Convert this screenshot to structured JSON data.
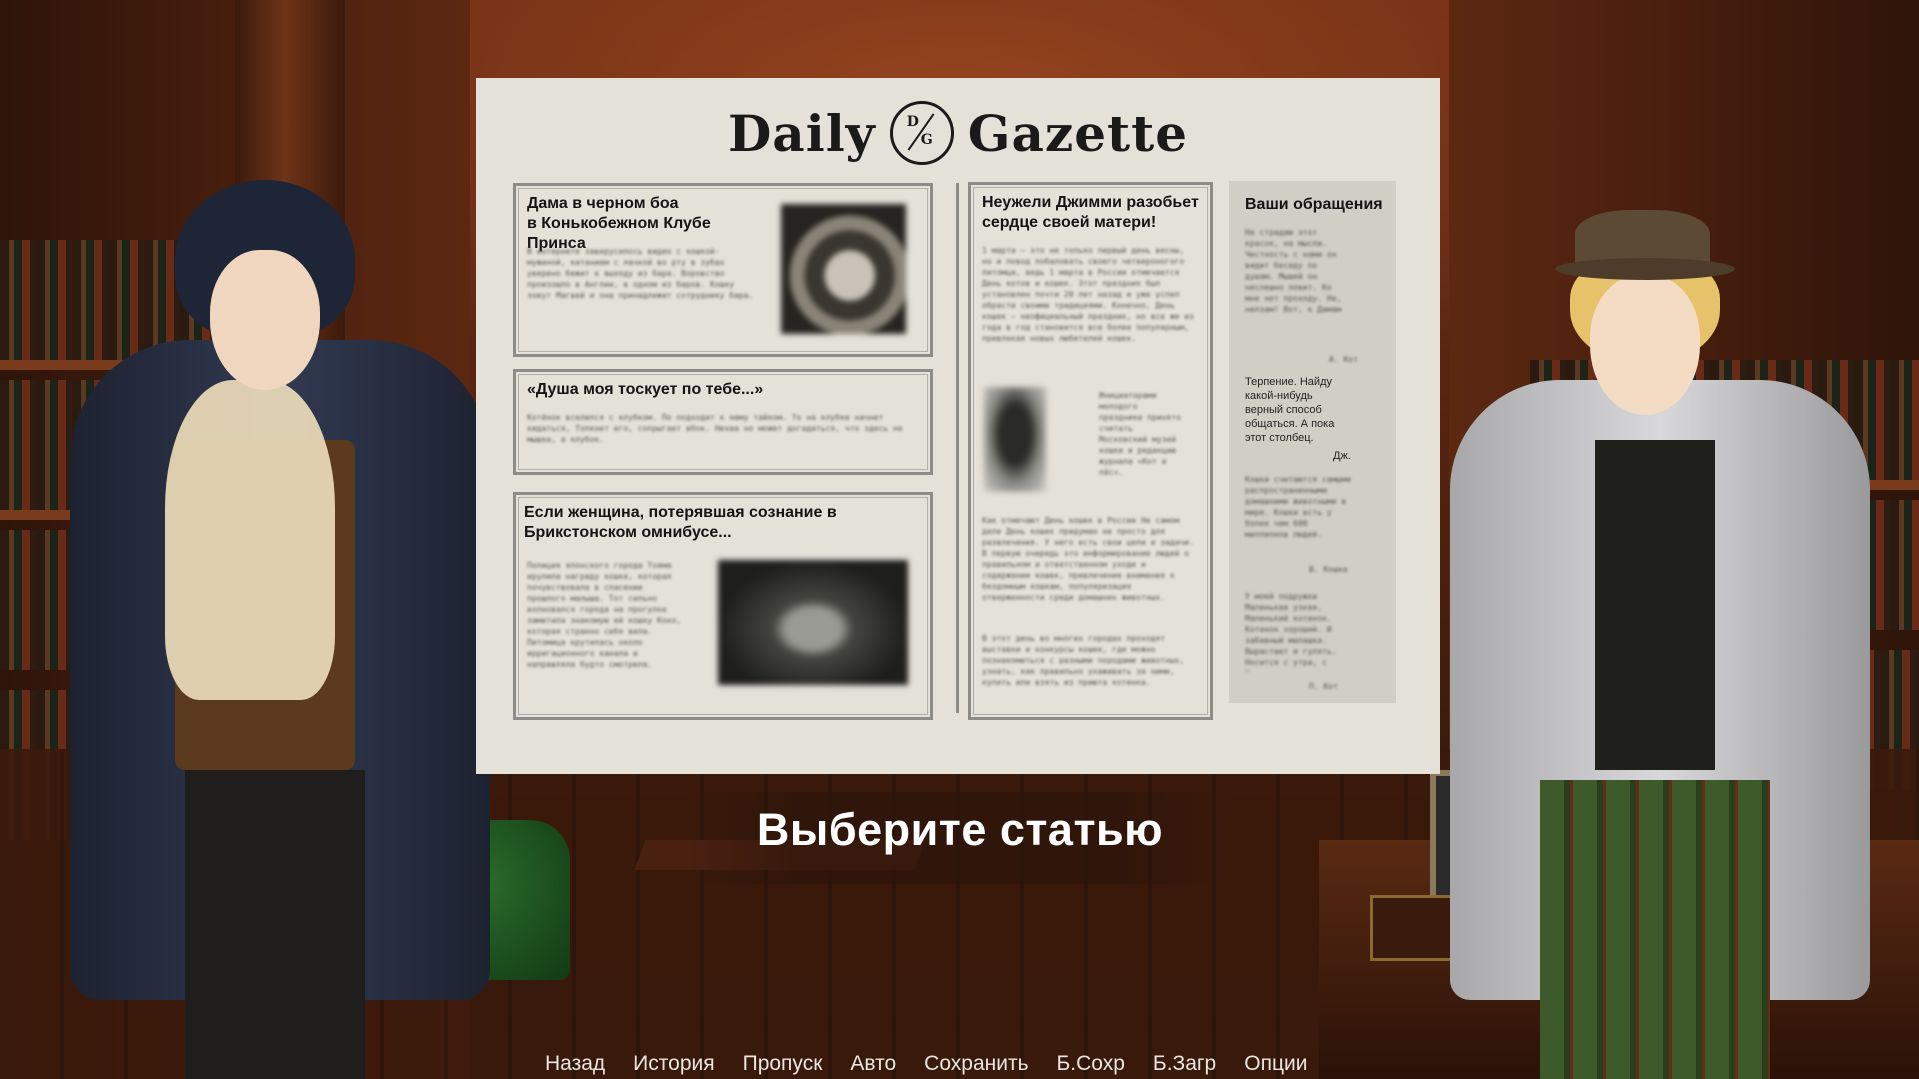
{
  "newspaper": {
    "masthead_left": "Daily",
    "masthead_right": "Gazette",
    "logo_top": "D",
    "logo_bottom": "G"
  },
  "articles": [
    {
      "headline_line1": "Дама в черном боа",
      "headline_line2": "в Конькобежном Клубе Принса",
      "body": "В интернете завирусилось видео с кошкой-мужиной, катанием с лачкой во рту в зубах уверено бежит к выходу из бара. Воровство произошло в Англии, в одном из баров. Кошку зовут Магвей и она принадлежит сотруднику бара."
    },
    {
      "headline": "«Душа моя тоскует по тебе...»",
      "body": "Котёнок вселился с клубком. По подходит к нему тайком. То на клубке начнет кидаться, Толкнет его, сопрыгает вбок. Нехаа но может догадаться, что здесь не мышка, а клубок."
    },
    {
      "headline_line1": "Если женщина, потерявшая сознание в",
      "headline_line2": "Брикстонском омнибусе...",
      "body": "Полиция японского города Тояма ирулила награду кошке, которая почувствовала в спасении прошлого малыша. Тот сильно волновался города на прогулке заметила знакомую ей кошку Коко, которая странно себя вела. Питомица крутилась около ирригационного канала и направляла будто смотрела."
    },
    {
      "headline_line1": "Неужели Джимми разобьет",
      "headline_line2": "сердце своей матери!",
      "body_top": "1 марта – это не только первый день весны, но и повод побаловать своего четвероногого питомца, ведь 1 марта в России отмечается День котов и кошек. Этот праздник был установлен почти 20 лет назад и уже успел обрасти своими традициями. Конечно, День кошек – неофициальный праздник, но все же из года в год становится все более популярным, привлекая новых любителей кошек.",
      "body_side": "Инициаторами молодого праздника принято считать Московский музей кошки и редакцию журнала «Кот и пёс».",
      "body_mid": "Как отмечают День кошек в России Не самом деле День кошек придуман не просто для развлечения. У него есть свои цели и задачи. В первую очередь это информирование людей о правильном и ответственном уходе и содержании кошек, привлечение внимания к бездомным кошкам, популяризация отверженности среди домашних животных.",
      "body_bottom": "В этот день во многих городах проходят выставки и конкурсы кошек, где можно познакомиться с разными породами животных, узнать, как правильно ухаживать за ними, купить или взять из приюта котенка."
    }
  ],
  "letters": {
    "title": "Ваши обращения",
    "letter1": "Не страдаю этот красок, на мысли. Честность с нами он видит беседу по душам. Мышей он неспешно ловит. Ко мне нет проходу. Не, нелзам! Вот, к Дамам коту в коне – мимо!",
    "letter1_sign": "А. Кот",
    "letter2": "Терпение. Найду какой-нибудь верный способ общаться. А пока этот столбец.",
    "letter2_sign": "Дж.",
    "letter3": "Кошки считаются самыми распространенными домашними животными в мире. Кошки есть у более чем 600 миллионов людей.",
    "letter3_sign": "В. Кошка",
    "letter4": "У моей подружки Маленькая узкая, Маленький котенок. Котенок хороший. И забавный милашка. Вырастает и гулять. Носится с утра, с Жульком ноав.",
    "letter4_sign": "П. Кот"
  },
  "prompt": "Выберите статью",
  "quick_menu": [
    "Назад",
    "История",
    "Пропуск",
    "Авто",
    "Сохранить",
    "Б.Сохр",
    "Б.Загр",
    "Опции"
  ]
}
